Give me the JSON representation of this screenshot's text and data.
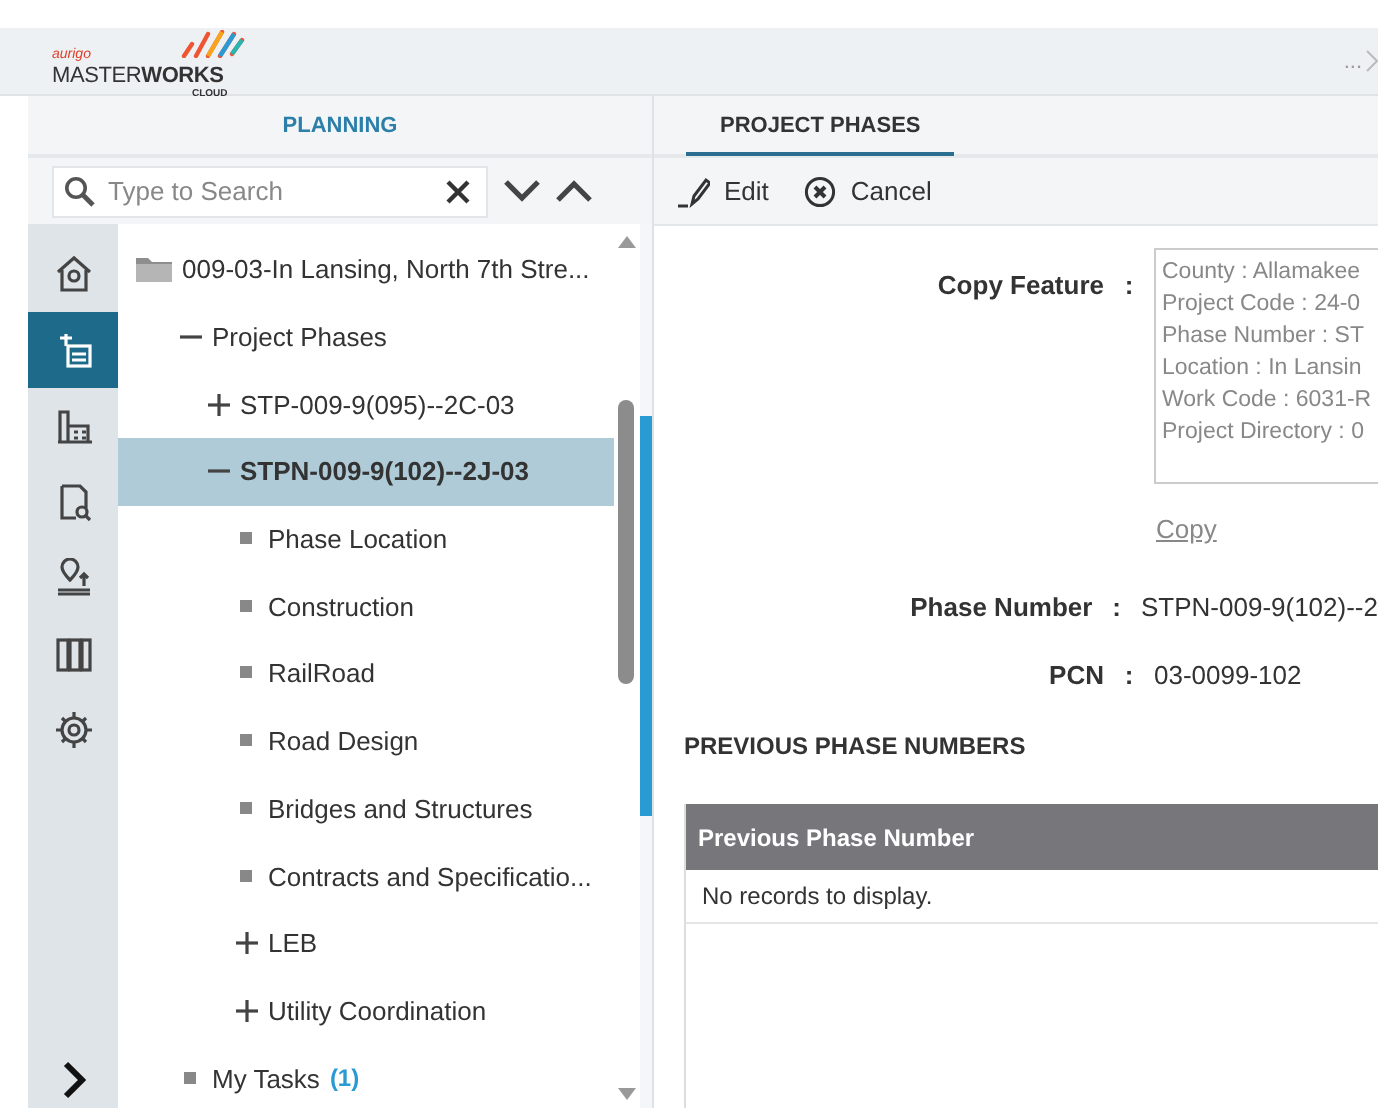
{
  "header": {
    "logo": {
      "brand": "aurigo",
      "product": "MASTER**WORKS**",
      "edition": "CLOUD"
    },
    "overflow": "..."
  },
  "left_panel": {
    "tab": "PLANNING",
    "search": {
      "placeholder": "Type to Search"
    },
    "rail": [
      {
        "selected": false
      },
      {
        "selected": true
      },
      {
        "selected": false
      },
      {
        "selected": false
      },
      {
        "selected": false
      },
      {
        "selected": false
      },
      {
        "selected": false
      }
    ],
    "tree": [
      {
        "label": "009-03-In Lansing, North 7th Stre...",
        "kind": "folder",
        "selected": false,
        "children": [
          {
            "label": "Project Phases",
            "kind": "toggle",
            "expanded": true,
            "selected": false,
            "children": [
              {
                "label": "STP-009-9(095)--2C-03",
                "kind": "toggle",
                "expanded": false,
                "selected": false
              },
              {
                "label": "STPN-009-9(102)--2J-03",
                "kind": "toggle",
                "expanded": true,
                "selected": true,
                "children": [
                  {
                    "label": "Phase Location",
                    "kind": "leaf",
                    "selected": false
                  },
                  {
                    "label": "Construction",
                    "kind": "leaf",
                    "selected": false
                  },
                  {
                    "label": "RailRoad",
                    "kind": "leaf",
                    "selected": false
                  },
                  {
                    "label": "Road Design",
                    "kind": "leaf",
                    "selected": false
                  },
                  {
                    "label": "Bridges and Structures",
                    "kind": "leaf",
                    "selected": false
                  },
                  {
                    "label": "Contracts and Specificatio...",
                    "kind": "leaf",
                    "selected": false
                  },
                  {
                    "label": "LEB",
                    "kind": "toggle",
                    "expanded": false,
                    "selected": false
                  },
                  {
                    "label": "Utility Coordination",
                    "kind": "toggle",
                    "expanded": false,
                    "selected": false
                  }
                ]
              }
            ]
          },
          {
            "label": "My Tasks",
            "kind": "leaf",
            "count": "(1)",
            "selected": false
          }
        ]
      }
    ]
  },
  "right_panel": {
    "tab": "PROJECT PHASES",
    "toolbar": [
      "Edit",
      "Cancel"
    ],
    "copy_feature": {
      "label": "Copy Feature",
      "separator": ":",
      "lines": [
        "County : Allamakee",
        "Project Code : 24-0",
        "Phase Number : ST",
        "Location : In Lansin",
        "Work Code : 6031-R",
        "Project Directory : 0"
      ],
      "link": "Copy"
    },
    "fields": [
      {
        "label": "Phase Number",
        "separator": ":",
        "value": "STPN-009-9(102)--2"
      },
      {
        "label": "PCN",
        "separator": ":",
        "value": "03-0099-102"
      }
    ],
    "section": "PREVIOUS PHASE NUMBERS",
    "table": {
      "columns": [
        "Previous Phase Number"
      ],
      "empty": "No records to display."
    }
  }
}
